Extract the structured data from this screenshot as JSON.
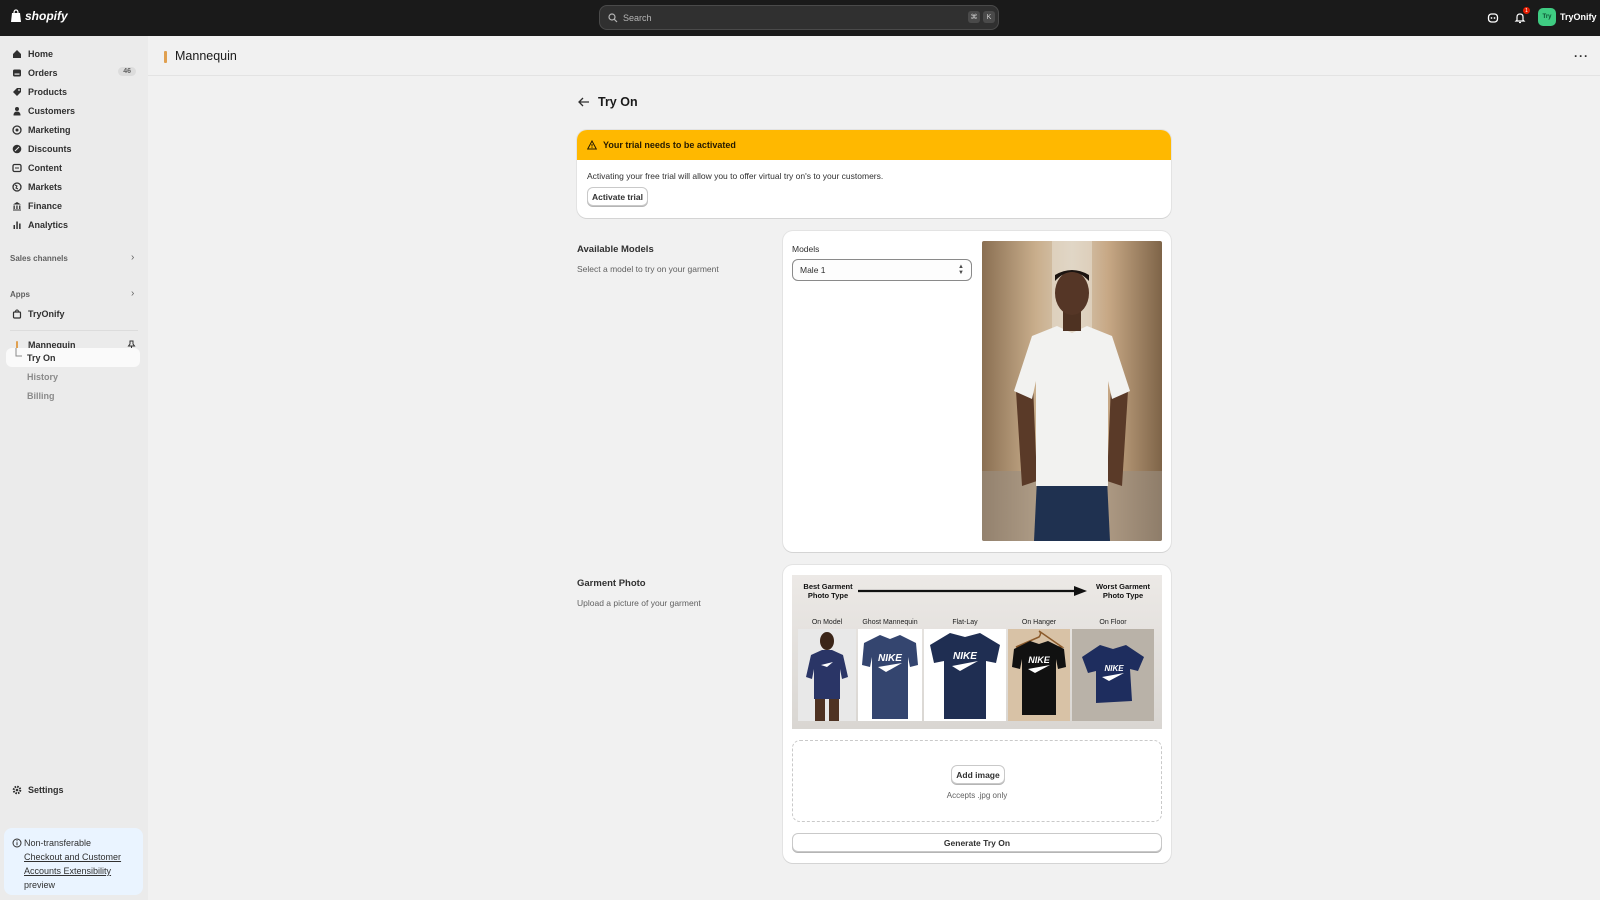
{
  "topbar": {
    "logo_text": "shopify",
    "search_placeholder": "Search",
    "shortcut_cmd": "⌘",
    "shortcut_key": "K",
    "notification_count": "1",
    "store_avatar": "Try",
    "store_name": "TryOnify"
  },
  "sidebar": {
    "items": [
      {
        "label": "Home",
        "icon": "home-icon"
      },
      {
        "label": "Orders",
        "icon": "orders-icon",
        "count": "46"
      },
      {
        "label": "Products",
        "icon": "tag-icon"
      },
      {
        "label": "Customers",
        "icon": "person-icon"
      },
      {
        "label": "Marketing",
        "icon": "target-icon"
      },
      {
        "label": "Discounts",
        "icon": "discount-icon"
      },
      {
        "label": "Content",
        "icon": "content-icon"
      },
      {
        "label": "Markets",
        "icon": "globe-icon"
      },
      {
        "label": "Finance",
        "icon": "bank-icon"
      },
      {
        "label": "Analytics",
        "icon": "bar-chart-icon"
      }
    ],
    "sales_channels_label": "Sales channels",
    "apps_label": "Apps",
    "app_tryonify": "TryOnify",
    "app_mannequin": "Mannequin",
    "sub_items": [
      "Try On",
      "History",
      "Billing"
    ],
    "settings_label": "Settings",
    "notice": {
      "text": "Non-transferable",
      "link": "Checkout and Customer Accounts Extensibility",
      "suffix": "preview"
    }
  },
  "header": {
    "title": "Mannequin"
  },
  "page": {
    "title": "Try On",
    "banner": {
      "title": "Your trial needs to be activated",
      "body": "Activating your free trial will allow you to offer virtual try on's to your customers.",
      "button": "Activate trial"
    },
    "models_section": {
      "title": "Available Models",
      "description": "Select a model to try on your garment",
      "field_label": "Models",
      "selected": "Male 1"
    },
    "garment_section": {
      "title": "Garment Photo",
      "description": "Upload a picture of your garment",
      "guide": {
        "best": "Best Garment Photo Type",
        "worst": "Worst Garment Photo Type",
        "types": [
          "On Model",
          "Ghost Mannequin",
          "Flat-Lay",
          "On Hanger",
          "On Floor"
        ]
      },
      "add_image": "Add image",
      "accepts": "Accepts .jpg only",
      "generate": "Generate Try On"
    }
  },
  "colors": {
    "topbar": "#1a1a1a",
    "banner": "#ffb800",
    "sidebar": "#ebebeb",
    "background": "#f1f1f1",
    "avatar": "#3fcc82"
  }
}
